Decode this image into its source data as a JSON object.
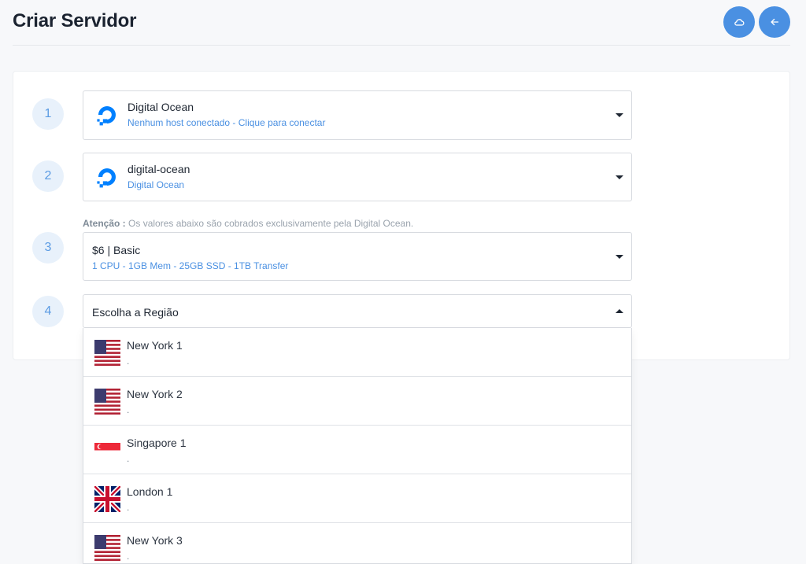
{
  "header": {
    "title": "Criar Servidor"
  },
  "steps": [
    {
      "number": "1",
      "main": "Digital Ocean",
      "sub": "Nenhum host conectado - Clique para conectar",
      "icon": "digitalocean-logo-icon"
    },
    {
      "number": "2",
      "main": "digital-ocean",
      "sub": "Digital Ocean",
      "icon": "digitalocean-logo-icon"
    },
    {
      "number": "3",
      "main": "$6 | Basic",
      "sub": "1 CPU - 1GB Mem - 25GB SSD - 1TB Transfer"
    },
    {
      "number": "4",
      "main": "Escolha a Região"
    }
  ],
  "warning": {
    "label": "Atenção :",
    "text": " Os valores abaixo são cobrados exclusivamente pela Digital Ocean."
  },
  "regions": [
    {
      "name": "New York 1",
      "desc": ".",
      "flag": "us-flag-icon"
    },
    {
      "name": "New York 2",
      "desc": ".",
      "flag": "us-flag-icon"
    },
    {
      "name": "Singapore 1",
      "desc": ".",
      "flag": "sg-flag-icon"
    },
    {
      "name": "London 1",
      "desc": ".",
      "flag": "uk-flag-icon"
    },
    {
      "name": "New York 3",
      "desc": ".",
      "flag": "us-flag-icon"
    }
  ],
  "colors": {
    "accent": "#4a90e2",
    "step_bg": "#e8f1fb",
    "border": "#d8dbe0"
  }
}
